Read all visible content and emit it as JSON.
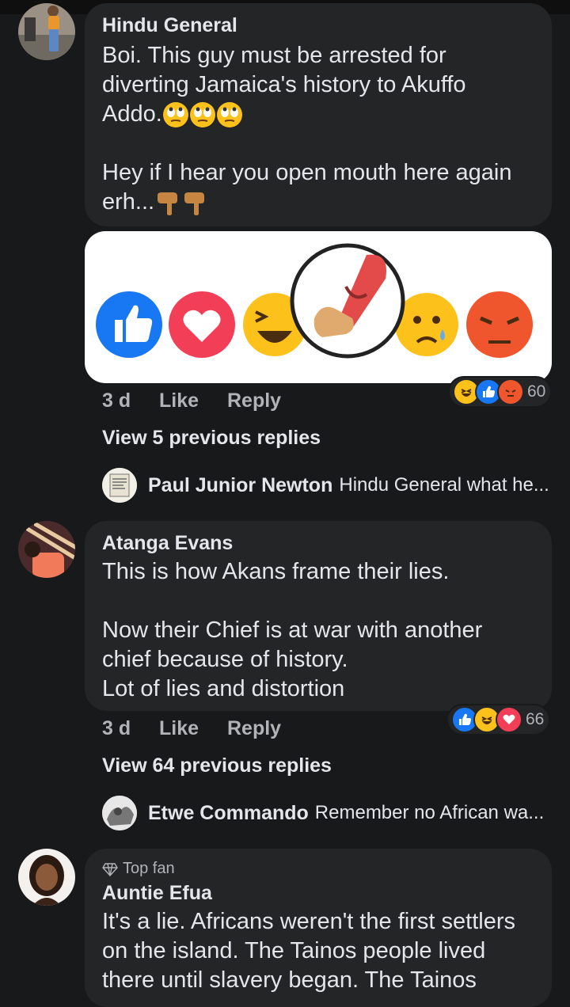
{
  "comments": [
    {
      "author": "Hindu General",
      "text_lines": [
        "Boi. This guy must be arrested for",
        "diverting Jamaica's history to Akuffo",
        "Addo."
      ],
      "text_lines2": [
        "Hey if I hear you open mouth here again",
        "erh..."
      ],
      "time": "3 d",
      "like_label": "Like",
      "reply_label": "Reply",
      "reaction_count": "60",
      "view_replies": "View 5 previous replies",
      "last_reply": {
        "author": "Paul Junior Newton",
        "text": "Hindu General what he..."
      }
    },
    {
      "author": "Atanga Evans",
      "text_lines": [
        "This is how Akans frame their lies."
      ],
      "text_lines2": [
        "Now their Chief is at war with another",
        "chief because of history.",
        "Lot of lies and distortion"
      ],
      "time": "3 d",
      "like_label": "Like",
      "reply_label": "Reply",
      "reaction_count": "66",
      "view_replies": "View 64 previous replies",
      "last_reply": {
        "author": "Etwe Commando",
        "text": "Remember no African wa..."
      }
    },
    {
      "badge": "Top fan",
      "author": "Auntie Efua",
      "text_lines": [
        "It's a lie. Africans weren't the first settlers",
        "on the island. The Tainos people lived",
        "there until slavery began. The Tainos"
      ]
    }
  ],
  "colors": {
    "background": "#18191a",
    "bubble": "#242526",
    "like_blue": "#1877f2",
    "love_red": "#f33e58"
  },
  "icons": [
    "eye-roll-emoji",
    "pointing-down-emoji",
    "like-reaction-icon",
    "love-reaction-icon",
    "haha-reaction-icon",
    "slipper-icon",
    "sad-reaction-icon",
    "angry-reaction-icon",
    "diamond-icon"
  ]
}
